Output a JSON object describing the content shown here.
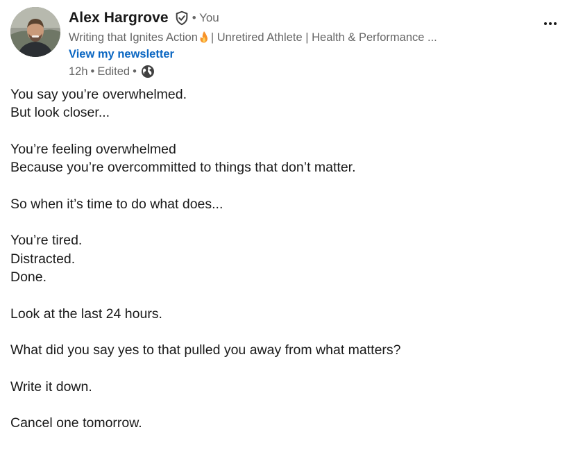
{
  "author": {
    "name": "Alex Hargrove",
    "you_label": "• You",
    "headline_before": "Writing that Ignites Action",
    "headline_after": "| Unretired Athlete | Health & Performance ...",
    "newsletter_link": "View my newsletter",
    "time": "12h",
    "sep1": "•",
    "edited": "Edited",
    "sep2": "•"
  },
  "icons": {
    "verified": "verified-shield-icon",
    "flame": "fire-emoji-icon",
    "visibility": "globe-icon",
    "menu": "more-options-icon"
  },
  "post": {
    "lines": [
      "You say you’re overwhelmed.",
      "But look closer...",
      "",
      "You’re feeling overwhelmed",
      "Because you’re overcommitted to things that don’t matter.",
      "",
      "So when it’s time to do what does...",
      "",
      "You’re tired.",
      "Distracted.",
      "Done.",
      "",
      "Look at the last 24 hours.",
      "",
      "What did you say yes to that pulled you away from what matters?",
      "",
      "Write it down.",
      "",
      "Cancel one tomorrow."
    ]
  },
  "colors": {
    "link": "#0a66c2",
    "text": "#191919",
    "muted": "#666666"
  }
}
